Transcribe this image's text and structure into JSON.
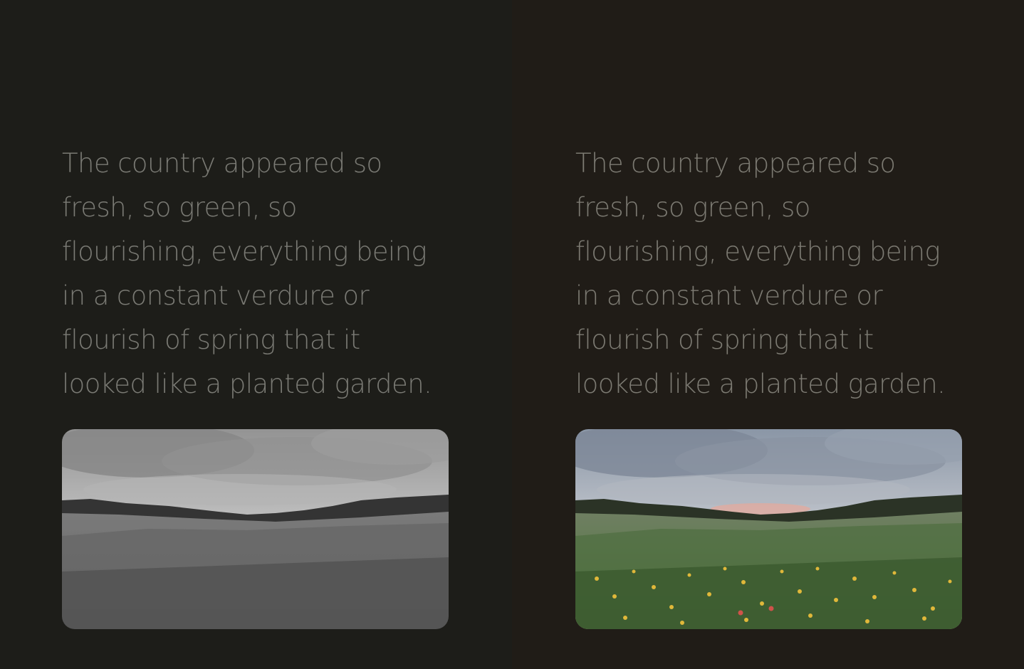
{
  "panels": [
    {
      "id": "grayscale",
      "quote_lines": [
        "The country appeared so",
        "fresh, so green, so",
        "flourishing, everything being",
        "in a constant verdure or",
        "flourish of spring that it",
        "looked like a planted garden."
      ],
      "image": {
        "subject": "meadow-landscape",
        "style": "grayscale"
      }
    },
    {
      "id": "color",
      "quote_lines": [
        "The country appeared so",
        "fresh, so green, so",
        "flourishing, everything being",
        "in a constant verdure or",
        "flourish of spring that it",
        "looked like a planted garden."
      ],
      "image": {
        "subject": "meadow-landscape",
        "style": "color"
      }
    }
  ],
  "colors": {
    "left_background": "#1d1d19",
    "right_background": "#201c17",
    "text": "#7a7a74"
  }
}
